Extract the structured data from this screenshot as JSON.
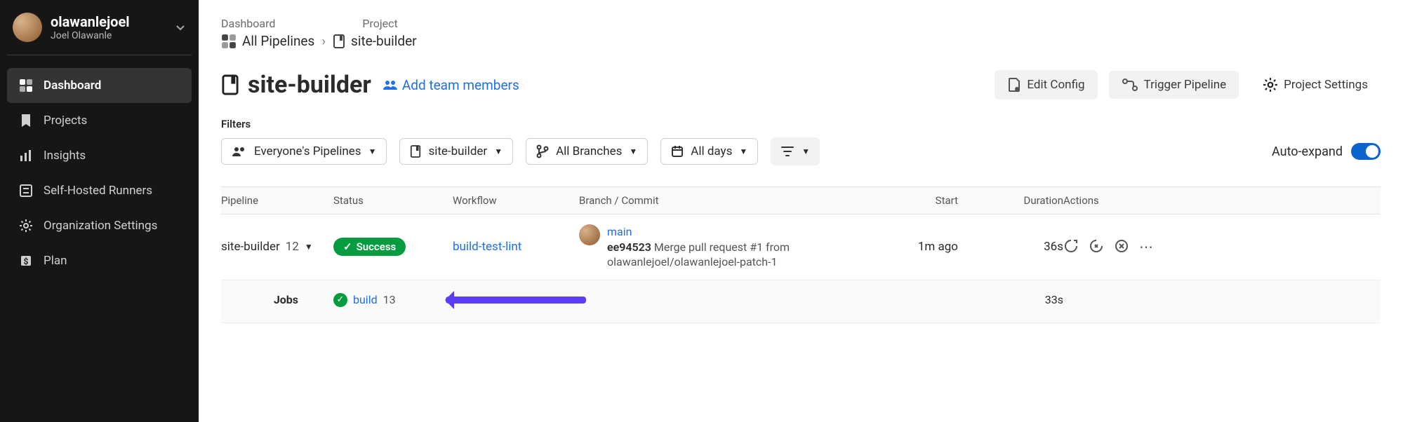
{
  "user": {
    "username": "olawanlejoel",
    "realname": "Joel Olawanle"
  },
  "nav": {
    "dashboard": "Dashboard",
    "projects": "Projects",
    "insights": "Insights",
    "runners": "Self-Hosted Runners",
    "org": "Organization Settings",
    "plan": "Plan"
  },
  "crumbs": {
    "dashboard": "Dashboard",
    "project": "Project",
    "all_pipelines": "All Pipelines",
    "project_name": "site-builder"
  },
  "title": "site-builder",
  "add_team": "Add team members",
  "buttons": {
    "edit_config": "Edit Config",
    "trigger": "Trigger Pipeline",
    "settings": "Project Settings"
  },
  "filters": {
    "label": "Filters",
    "pipelines": "Everyone's Pipelines",
    "project": "site-builder",
    "branches": "All Branches",
    "days": "All days",
    "auto_expand": "Auto-expand"
  },
  "columns": {
    "pipeline": "Pipeline",
    "status": "Status",
    "workflow": "Workflow",
    "branch": "Branch / Commit",
    "start": "Start",
    "duration": "Duration",
    "actions": "Actions"
  },
  "row": {
    "pipeline_name": "site-builder",
    "pipeline_num": "12",
    "status": "Success",
    "workflow": "build-test-lint",
    "branch": "main",
    "commit_hash": "ee94523",
    "commit_msg": "Merge pull request #1 from olawanlejoel/olawanlejoel-patch-1",
    "start": "1m ago",
    "duration": "36s"
  },
  "jobs": {
    "label": "Jobs",
    "name": "build",
    "num": "13",
    "duration": "33s"
  }
}
